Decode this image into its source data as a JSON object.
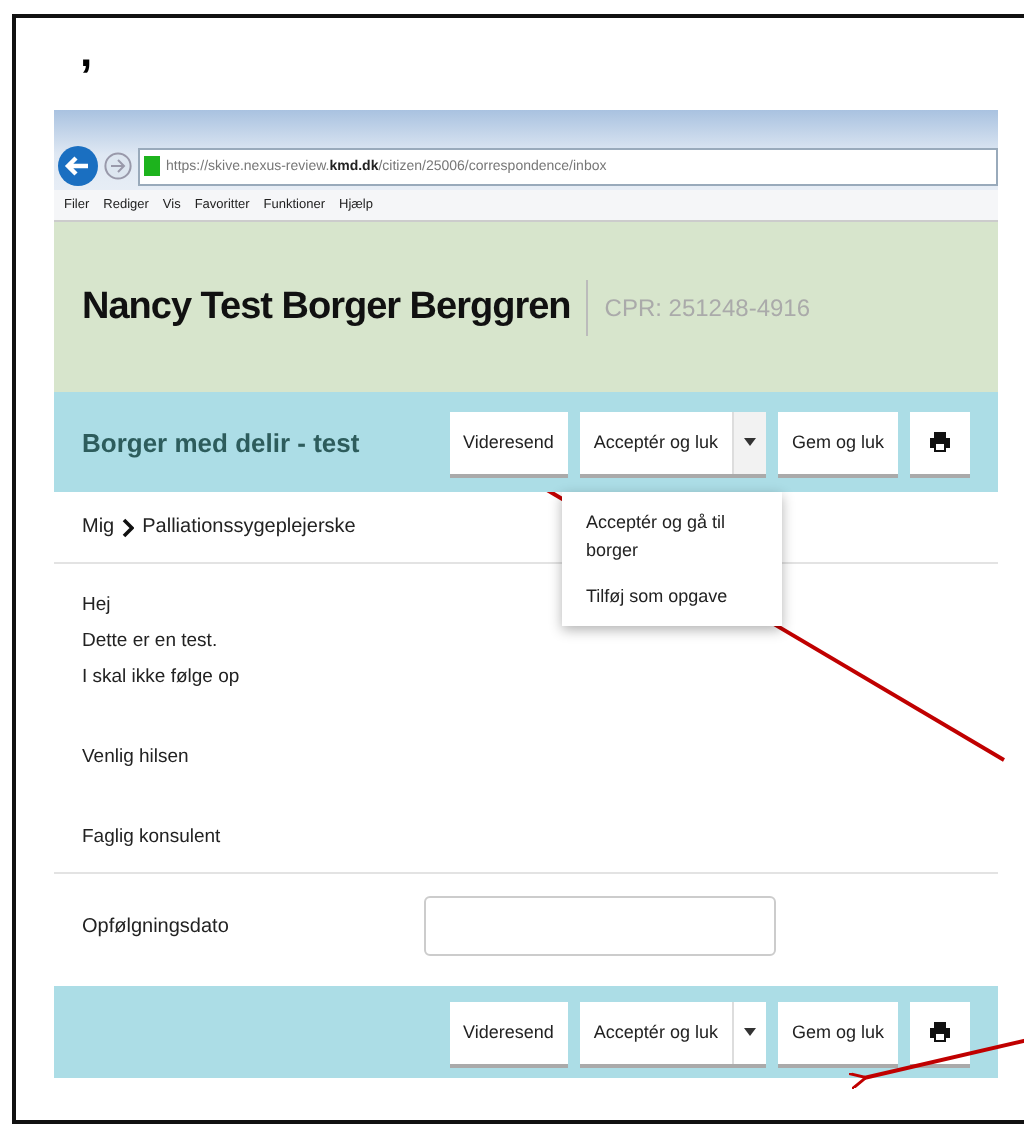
{
  "caption": ",",
  "browser": {
    "url": "https://skive.nexus-review.**kmd.dk**/citizen/25006/correspondence/inbox",
    "menu": [
      "Filer",
      "Rediger",
      "Vis",
      "Favoritter",
      "Funktioner",
      "Hjælp"
    ]
  },
  "citizen": {
    "name": "Nancy Test Borger Berggren",
    "cpr": "CPR: 251248-4916"
  },
  "toolbar": {
    "title": "Borger med delir - test",
    "buttons": [
      {
        "kind": "button",
        "label": "Videresend"
      },
      {
        "kind": "split",
        "label": "Acceptér og luk",
        "expanded": true,
        "menu": [
          "Acceptér og gå til borger",
          "Tilføj som opgave"
        ]
      },
      {
        "kind": "button",
        "label": "Gem og luk"
      },
      {
        "kind": "print"
      }
    ]
  },
  "breadcrumb": [
    "Mig",
    "Palliationssygeplejerske"
  ],
  "message": [
    [
      "Hej",
      "Dette er en test.",
      "I skal ikke følge op"
    ],
    [
      "Venlig hilsen"
    ],
    [
      "Faglig konsulent"
    ]
  ],
  "followup": {
    "label": "Opfølgningsdato"
  },
  "footer": {
    "buttons": [
      {
        "kind": "button",
        "label": "Videresend"
      },
      {
        "kind": "split",
        "label": "Acceptér og luk",
        "expanded": false
      },
      {
        "kind": "button",
        "label": "Gem og luk"
      },
      {
        "kind": "print"
      }
    ]
  }
}
